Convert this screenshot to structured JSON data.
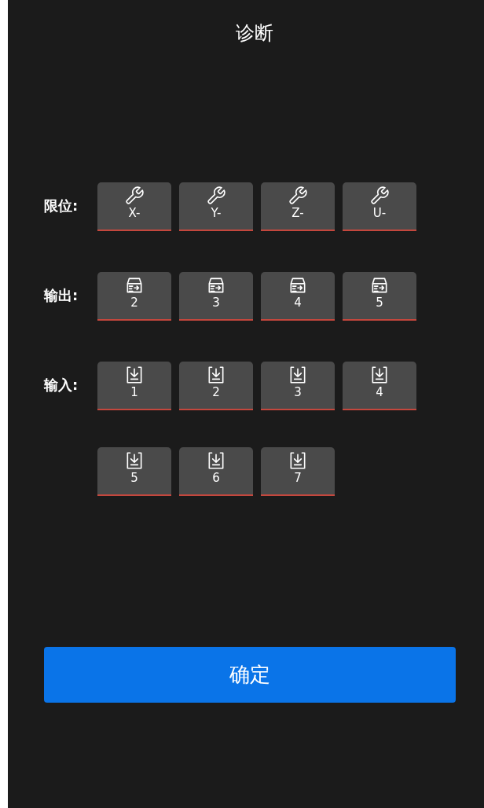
{
  "title": "诊断",
  "groups": [
    {
      "label": "限位:",
      "kind": "wrench",
      "buttons": [
        "X-",
        "Y-",
        "Z-",
        "U-"
      ]
    },
    {
      "label": "输出:",
      "kind": "output",
      "buttons": [
        "2",
        "3",
        "4",
        "5"
      ]
    },
    {
      "label": "输入:",
      "kind": "input",
      "buttons": [
        "1",
        "2",
        "3",
        "4",
        "5",
        "6",
        "7"
      ]
    }
  ],
  "confirm": "确定"
}
